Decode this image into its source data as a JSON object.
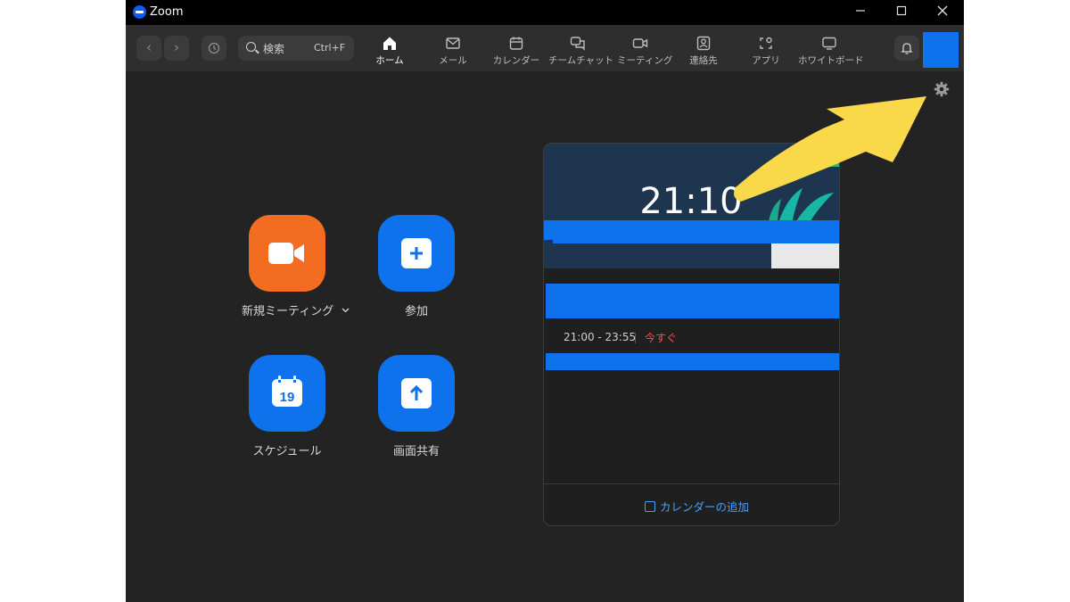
{
  "window": {
    "title": "Zoom"
  },
  "toolbar": {
    "search_label": "検索",
    "search_shortcut": "Ctrl+F",
    "tabs": [
      {
        "label": "ホーム",
        "icon": "home-icon"
      },
      {
        "label": "メール",
        "icon": "mail-icon"
      },
      {
        "label": "カレンダー",
        "icon": "calendar-icon"
      },
      {
        "label": "チームチャット",
        "icon": "chat-icon"
      },
      {
        "label": "ミーティング",
        "icon": "video-icon"
      },
      {
        "label": "連絡先",
        "icon": "contact-icon"
      },
      {
        "label": "アプリ",
        "icon": "apps-icon"
      },
      {
        "label": "ホワイトボード",
        "icon": "whiteboard-icon"
      }
    ]
  },
  "actions": {
    "new_meeting": "新規ミーティング",
    "join": "参加",
    "schedule": "スケジュール",
    "schedule_day": "19",
    "share_screen": "画面共有"
  },
  "calendar_card": {
    "clock": "21:10",
    "event_time": "21:00 - 23:55",
    "event_status": "今すぐ",
    "add_calendar": "カレンダーの追加"
  },
  "colors": {
    "background": "#232323",
    "toolbar": "#2e2e2e",
    "accent_blue": "#0e72ed",
    "accent_orange": "#f26d21",
    "status_red": "#ff4d4d",
    "annotation_yellow": "#f9d84a"
  }
}
